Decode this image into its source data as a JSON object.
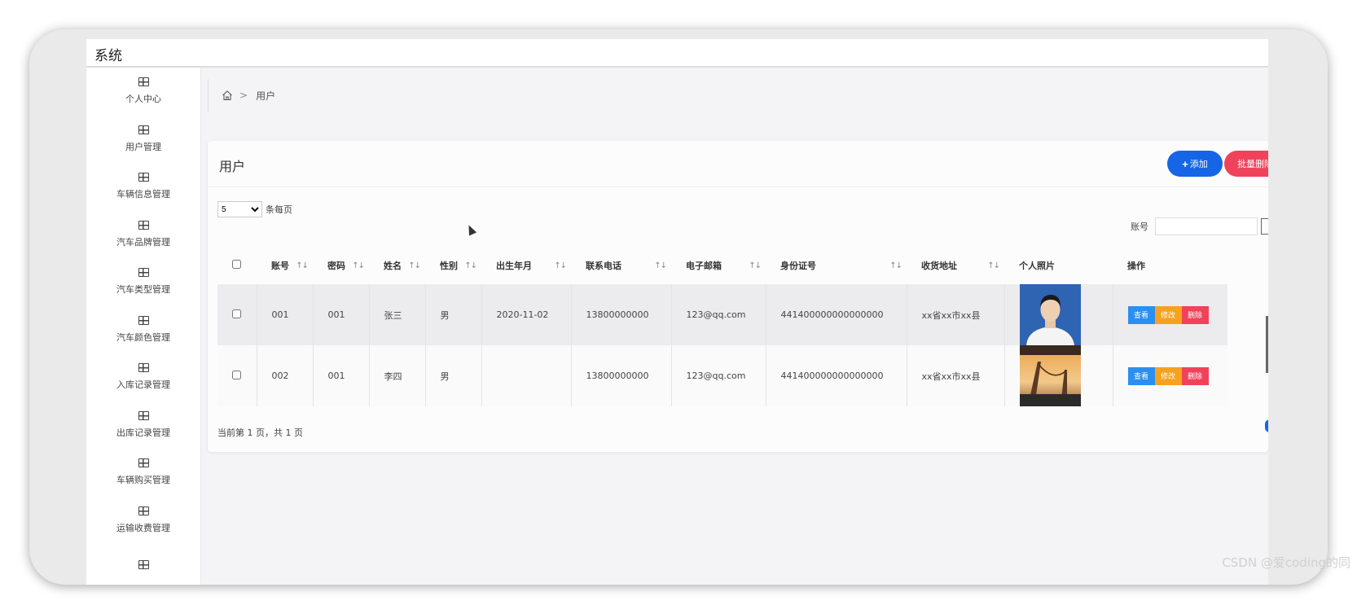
{
  "app": {
    "title": "系统"
  },
  "sidebar": {
    "items": [
      {
        "label": "个人中心",
        "icon": "grid-icon"
      },
      {
        "label": "用户管理",
        "icon": "grid-icon"
      },
      {
        "label": "车辆信息管理",
        "icon": "grid-icon"
      },
      {
        "label": "汽车品牌管理",
        "icon": "grid-icon"
      },
      {
        "label": "汽车类型管理",
        "icon": "grid-icon"
      },
      {
        "label": "汽车颜色管理",
        "icon": "grid-icon"
      },
      {
        "label": "入库记录管理",
        "icon": "grid-icon"
      },
      {
        "label": "出库记录管理",
        "icon": "grid-icon"
      },
      {
        "label": "车辆购买管理",
        "icon": "grid-icon"
      },
      {
        "label": "运输收费管理",
        "icon": "grid-icon"
      }
    ]
  },
  "breadcrumb": {
    "home_icon": "home-icon",
    "separator": ">",
    "current": "用户"
  },
  "card": {
    "title": "用户",
    "add_label": "添加",
    "batch_delete_label": "批量删除",
    "page_size": "5",
    "page_size_suffix": "条每页",
    "search_label": "账号",
    "search_value": ""
  },
  "table": {
    "headers": [
      "账号",
      "密码",
      "姓名",
      "性别",
      "出生年月",
      "联系电话",
      "电子邮箱",
      "身份证号",
      "收货地址",
      "个人照片",
      "操作"
    ],
    "sort_glyph": "↑↓",
    "rows": [
      {
        "account": "001",
        "password": "001",
        "name": "张三",
        "gender": "男",
        "birth": "2020-11-02",
        "phone": "13800000000",
        "email": "123@qq.com",
        "id_no": "441400000000000000",
        "address": "xx省xx市xx县"
      },
      {
        "account": "002",
        "password": "001",
        "name": "李四",
        "gender": "男",
        "birth": "",
        "phone": "13800000000",
        "email": "123@qq.com",
        "id_no": "441400000000000000",
        "address": "xx省xx市xx县"
      }
    ],
    "ops": {
      "view": "查看",
      "edit": "修改",
      "delete": "删除"
    }
  },
  "footer": {
    "page_info": "当前第 1 页，共 1 页"
  },
  "watermark": "CSDN @爱coding的同"
}
